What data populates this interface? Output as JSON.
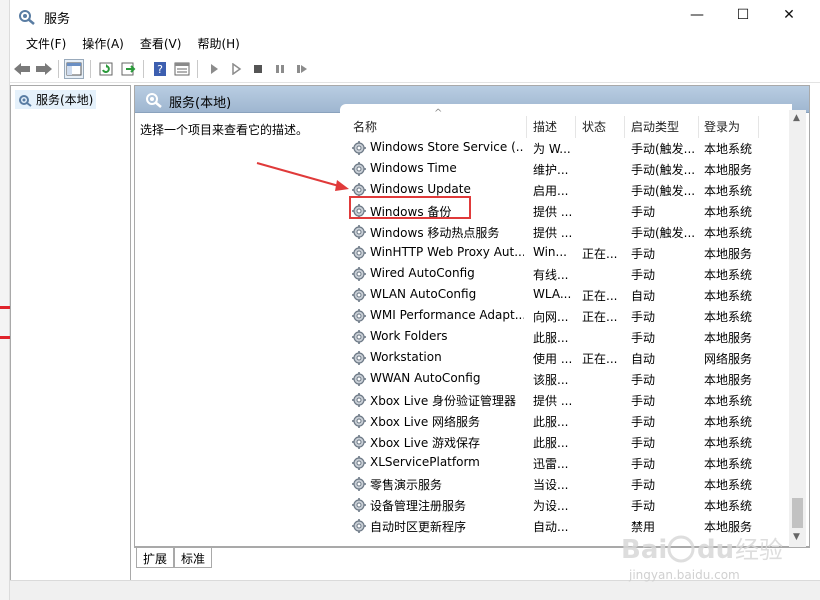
{
  "window": {
    "title": "服务",
    "controls": {
      "minimize": "—",
      "maximize": "☐",
      "close": "✕"
    }
  },
  "menu": [
    "文件(F)",
    "操作(A)",
    "查看(V)",
    "帮助(H)"
  ],
  "tree": {
    "root_label": "服务(本地)"
  },
  "pane": {
    "header": "服务(本地)",
    "description_prompt": "选择一个项目来查看它的描述。"
  },
  "columns": {
    "name": "名称",
    "desc": "描述",
    "status": "状态",
    "startup": "启动类型",
    "logon": "登录为"
  },
  "services": [
    {
      "name": "Windows Store Service (...",
      "desc": "为 W...",
      "status": "",
      "startup": "手动(触发...",
      "logon": "本地系统"
    },
    {
      "name": "Windows Time",
      "desc": "维护...",
      "status": "",
      "startup": "手动(触发...",
      "logon": "本地服务"
    },
    {
      "name": "Windows Update",
      "desc": "启用...",
      "status": "",
      "startup": "手动(触发...",
      "logon": "本地系统"
    },
    {
      "name": "Windows 备份",
      "desc": "提供 ...",
      "status": "",
      "startup": "手动",
      "logon": "本地系统"
    },
    {
      "name": "Windows 移动热点服务",
      "desc": "提供 ...",
      "status": "",
      "startup": "手动(触发...",
      "logon": "本地系统"
    },
    {
      "name": "WinHTTP Web Proxy Aut...",
      "desc": "Win...",
      "status": "正在...",
      "startup": "手动",
      "logon": "本地服务"
    },
    {
      "name": "Wired AutoConfig",
      "desc": "有线...",
      "status": "",
      "startup": "手动",
      "logon": "本地系统"
    },
    {
      "name": "WLAN AutoConfig",
      "desc": "WLA...",
      "status": "正在...",
      "startup": "自动",
      "logon": "本地系统"
    },
    {
      "name": "WMI Performance Adapt...",
      "desc": "向网...",
      "status": "正在...",
      "startup": "手动",
      "logon": "本地系统"
    },
    {
      "name": "Work Folders",
      "desc": "此服...",
      "status": "",
      "startup": "手动",
      "logon": "本地服务"
    },
    {
      "name": "Workstation",
      "desc": "使用 ...",
      "status": "正在...",
      "startup": "自动",
      "logon": "网络服务"
    },
    {
      "name": "WWAN AutoConfig",
      "desc": "该服...",
      "status": "",
      "startup": "手动",
      "logon": "本地服务"
    },
    {
      "name": "Xbox Live 身份验证管理器",
      "desc": "提供 ...",
      "status": "",
      "startup": "手动",
      "logon": "本地系统"
    },
    {
      "name": "Xbox Live 网络服务",
      "desc": "此服...",
      "status": "",
      "startup": "手动",
      "logon": "本地系统"
    },
    {
      "name": "Xbox Live 游戏保存",
      "desc": "此服...",
      "status": "",
      "startup": "手动",
      "logon": "本地系统"
    },
    {
      "name": "XLServicePlatform",
      "desc": "迅雷...",
      "status": "",
      "startup": "手动",
      "logon": "本地系统"
    },
    {
      "name": "零售演示服务",
      "desc": "当设...",
      "status": "",
      "startup": "手动",
      "logon": "本地系统"
    },
    {
      "name": "设备管理注册服务",
      "desc": "为设...",
      "status": "",
      "startup": "手动",
      "logon": "本地系统"
    },
    {
      "name": "自动时区更新程序",
      "desc": "自动...",
      "status": "",
      "startup": "禁用",
      "logon": "本地服务"
    }
  ],
  "tabs": [
    "扩展",
    "标准"
  ],
  "watermark": {
    "brand": "Bai du 经验",
    "url": "jingyan.baidu.com"
  },
  "colors": {
    "highlight": "#e03a3a",
    "header_bg": "#b9cde2"
  }
}
